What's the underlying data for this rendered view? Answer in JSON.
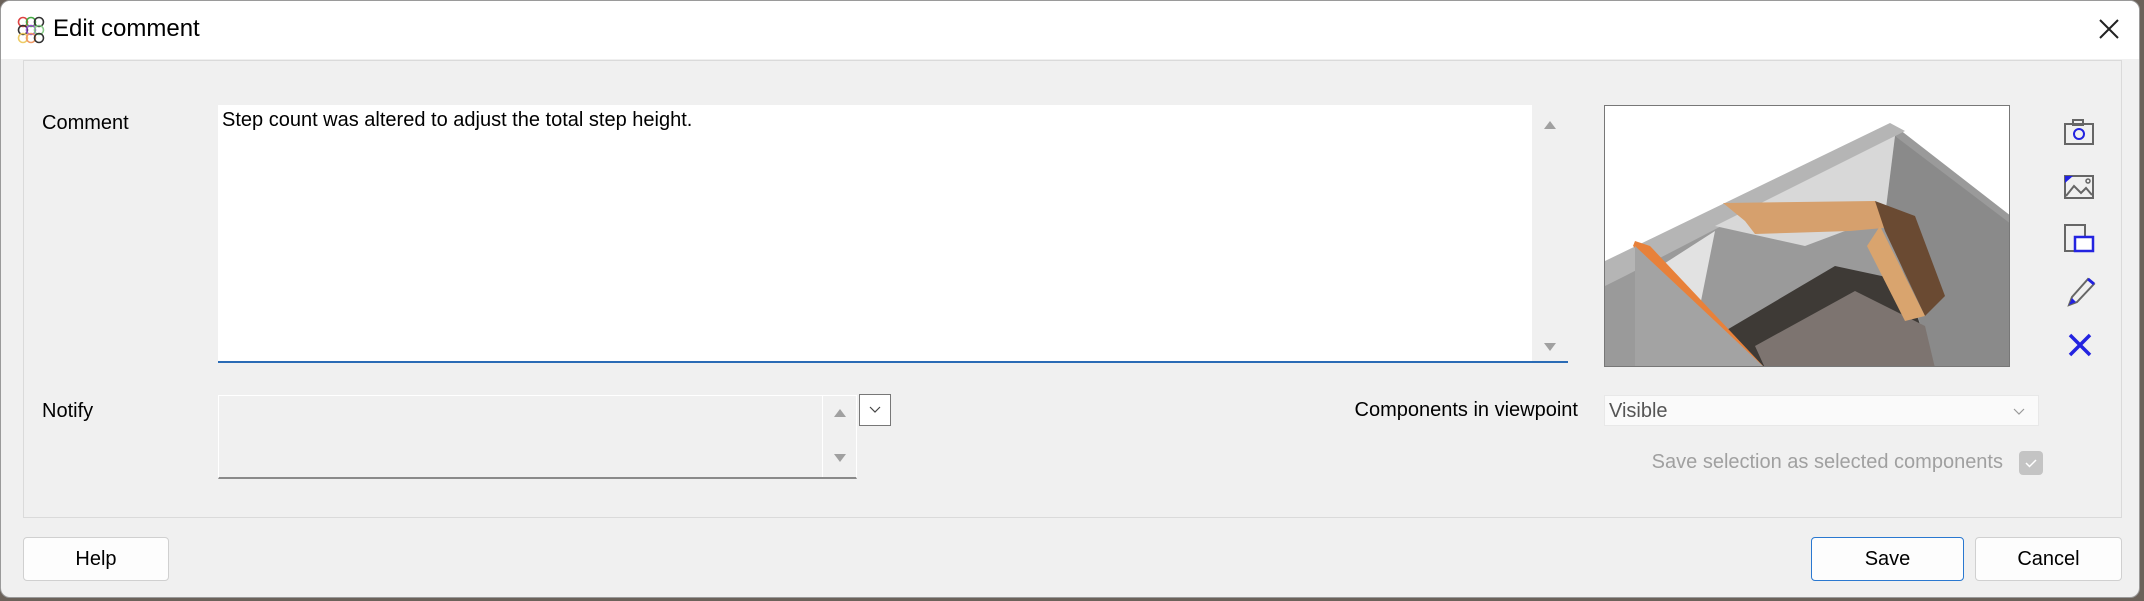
{
  "window": {
    "title": "Edit comment"
  },
  "comment": {
    "label": "Comment",
    "value": "Step count was altered to adjust the total step height."
  },
  "notify": {
    "label": "Notify",
    "value": ""
  },
  "components": {
    "label": "Components in viewpoint",
    "selected": "Visible"
  },
  "save_selection": {
    "label": "Save selection as selected components",
    "checked": true,
    "disabled": true
  },
  "toolbar": {
    "icons": [
      "camera-icon",
      "image-icon",
      "paste-icon",
      "pencil-icon",
      "delete-icon"
    ],
    "accent": "#2323e0"
  },
  "buttons": {
    "help": "Help",
    "save": "Save",
    "cancel": "Cancel"
  }
}
